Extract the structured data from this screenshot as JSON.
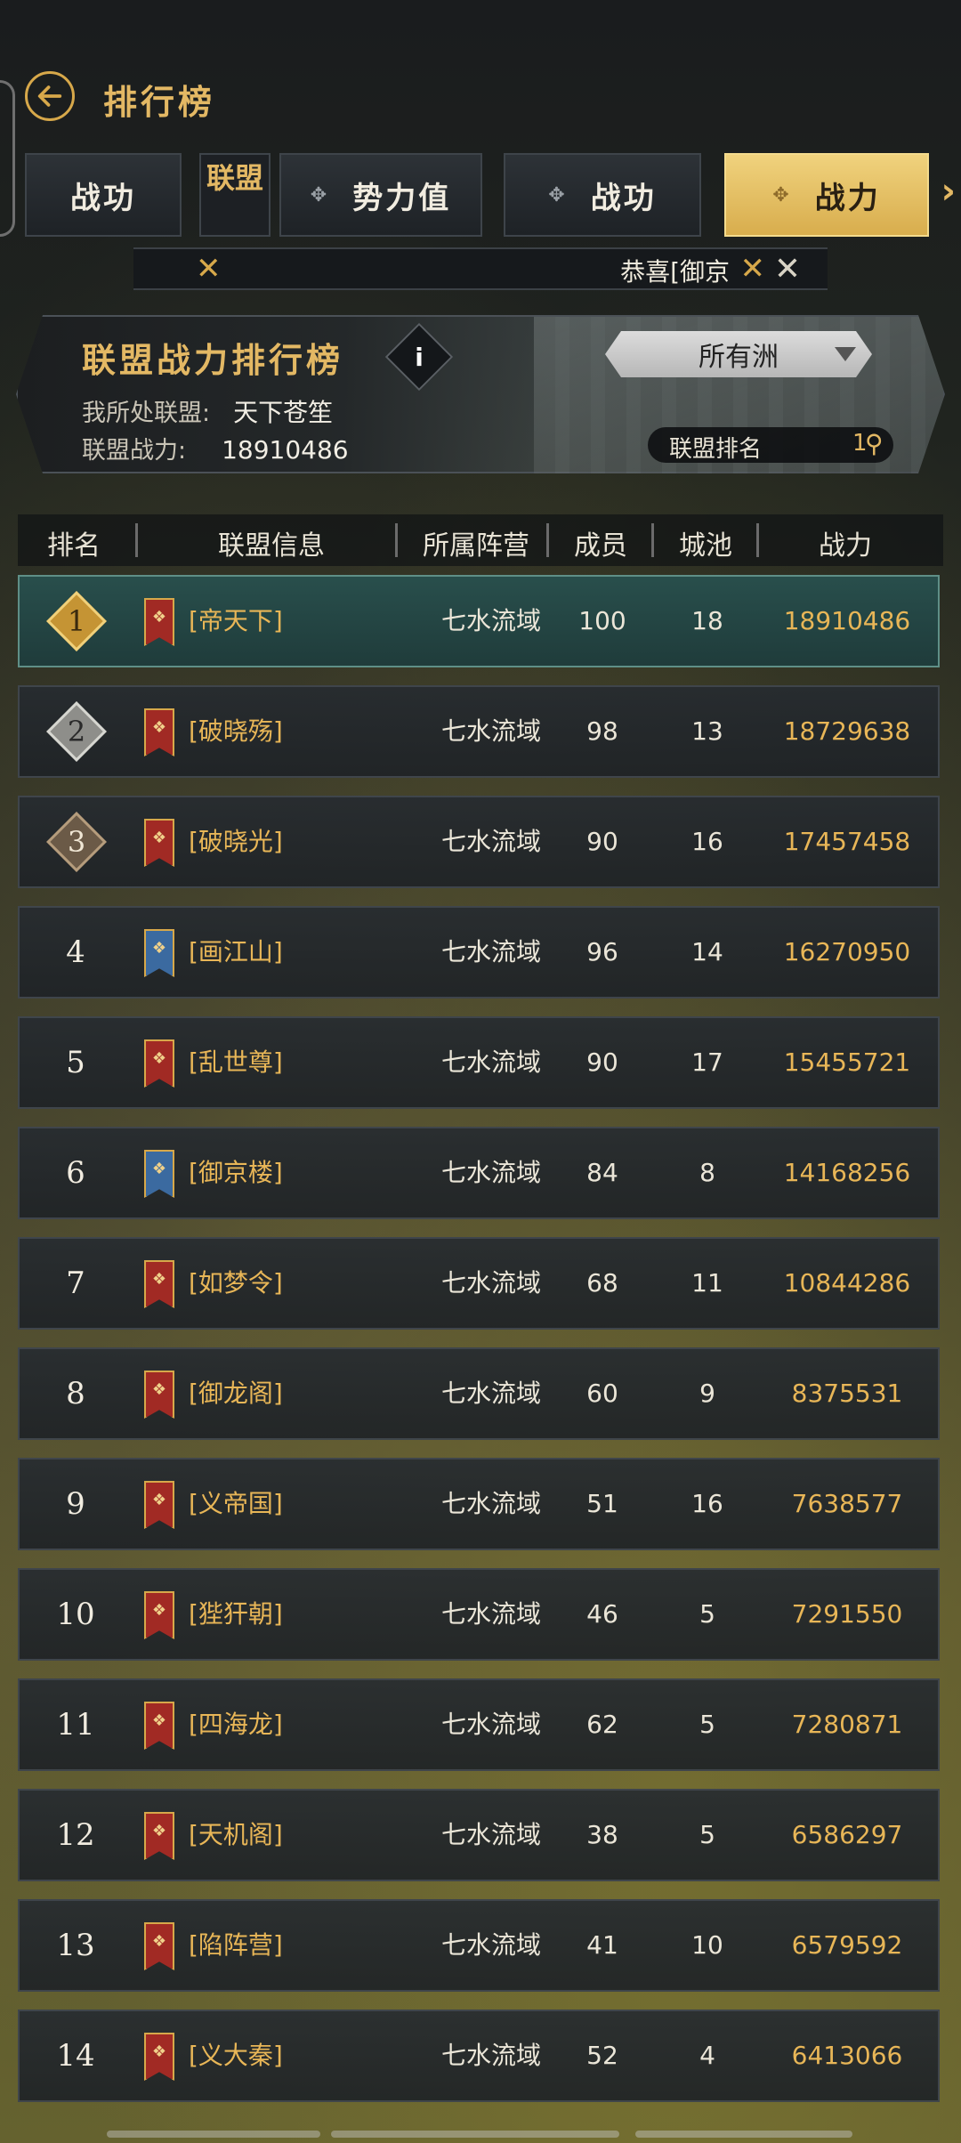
{
  "header": {
    "title": "排行榜"
  },
  "tabs": [
    {
      "label": "战功",
      "active": false
    },
    {
      "label": "势力值",
      "active": false
    },
    {
      "label": "战功",
      "active": false
    },
    {
      "label": "战力",
      "active": true
    }
  ],
  "tab_group_label": "联盟",
  "marquee": {
    "text": "恭喜[御京"
  },
  "banner": {
    "title": "联盟战力排行榜",
    "my_alliance_label": "我所处联盟:",
    "my_alliance_value": "天下苍笙",
    "alliance_power_label": "联盟战力:",
    "alliance_power_value": "18910486",
    "region_select": "所有洲",
    "rank_label": "联盟排名",
    "rank_value": "1"
  },
  "table": {
    "headers": [
      "排名",
      "联盟信息",
      "所属阵营",
      "成员",
      "城池",
      "战力"
    ],
    "rows": [
      {
        "rank": "1",
        "name": "[帝天下]",
        "camp": "七水流域",
        "members": "100",
        "cities": "18",
        "power": "18910486",
        "flag": "red"
      },
      {
        "rank": "2",
        "name": "[破晓殇]",
        "camp": "七水流域",
        "members": "98",
        "cities": "13",
        "power": "18729638",
        "flag": "red"
      },
      {
        "rank": "3",
        "name": "[破晓光]",
        "camp": "七水流域",
        "members": "90",
        "cities": "16",
        "power": "17457458",
        "flag": "red"
      },
      {
        "rank": "4",
        "name": "[画江山]",
        "camp": "七水流域",
        "members": "96",
        "cities": "14",
        "power": "16270950",
        "flag": "blue"
      },
      {
        "rank": "5",
        "name": "[乱世尊]",
        "camp": "七水流域",
        "members": "90",
        "cities": "17",
        "power": "15455721",
        "flag": "red"
      },
      {
        "rank": "6",
        "name": "[御京楼]",
        "camp": "七水流域",
        "members": "84",
        "cities": "8",
        "power": "14168256",
        "flag": "blue"
      },
      {
        "rank": "7",
        "name": "[如梦令]",
        "camp": "七水流域",
        "members": "68",
        "cities": "11",
        "power": "10844286",
        "flag": "red"
      },
      {
        "rank": "8",
        "name": "[御龙阁]",
        "camp": "七水流域",
        "members": "60",
        "cities": "9",
        "power": "8375531",
        "flag": "red"
      },
      {
        "rank": "9",
        "name": "[义帝国]",
        "camp": "七水流域",
        "members": "51",
        "cities": "16",
        "power": "7638577",
        "flag": "red"
      },
      {
        "rank": "10",
        "name": "[狴犴朝]",
        "camp": "七水流域",
        "members": "46",
        "cities": "5",
        "power": "7291550",
        "flag": "red"
      },
      {
        "rank": "11",
        "name": "[四海龙]",
        "camp": "七水流域",
        "members": "62",
        "cities": "5",
        "power": "7280871",
        "flag": "red"
      },
      {
        "rank": "12",
        "name": "[天机阁]",
        "camp": "七水流域",
        "members": "38",
        "cities": "5",
        "power": "6586297",
        "flag": "red"
      },
      {
        "rank": "13",
        "name": "[陷阵营]",
        "camp": "七水流域",
        "members": "41",
        "cities": "10",
        "power": "6579592",
        "flag": "red"
      },
      {
        "rank": "14",
        "name": "[义大秦]",
        "camp": "七水流域",
        "members": "52",
        "cities": "4",
        "power": "6413066",
        "flag": "red"
      }
    ]
  },
  "colors": {
    "accent_gold": "#e3b864",
    "power_gold": "#e8b657",
    "flag_red": "#a12a24",
    "flag_blue": "#3b6aa0"
  }
}
